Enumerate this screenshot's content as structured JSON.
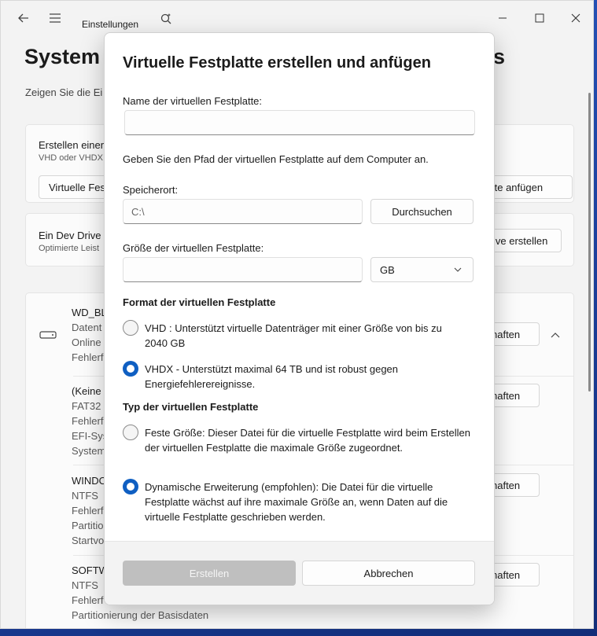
{
  "app": {
    "title": "Einstellungen"
  },
  "page": {
    "title": "System",
    "title_suffix": "s",
    "subtitle": "Zeigen Sie die Ei"
  },
  "cards": {
    "vhd": {
      "title": "Erstellen einer",
      "desc": "VHD oder VHDX",
      "btn_left": "Virtuelle Fes",
      "btn_right": "tte anfügen"
    },
    "devdrive": {
      "title": "Ein Dev Drive",
      "desc": "Optimierte Leist",
      "btn_right": "ive erstellen"
    }
  },
  "disks": [
    {
      "lines": [
        "WD_BL",
        "Datent",
        "Online",
        "Fehlerf"
      ],
      "btn": "haften"
    },
    {
      "lines": [
        "(Keine",
        "FAT32",
        "Fehlerf",
        "EFI-Sys",
        "System"
      ],
      "btn": "haften"
    },
    {
      "lines": [
        "WINDO",
        "NTFS",
        "Fehlerf",
        "Partitio",
        "Startvo"
      ],
      "btn": "haften"
    },
    {
      "lines": [
        "SOFTW",
        "NTFS",
        "Fehlerf",
        "Partitionierung der Basisdaten"
      ],
      "btn": "haften"
    }
  ],
  "dialog": {
    "title": "Virtuelle Festplatte erstellen und anfügen",
    "name_label": "Name der virtuellen Festplatte:",
    "name_value": "",
    "path_hint": "Geben Sie den Pfad der virtuellen Festplatte auf dem Computer an.",
    "location_label": "Speicherort:",
    "location_value": "C:\\",
    "browse_label": "Durchsuchen",
    "size_label": "Größe der virtuellen Festplatte:",
    "size_value": "",
    "unit_value": "GB",
    "format_heading": "Format der virtuellen Festplatte",
    "format_options": [
      {
        "text": "VHD : Unterstützt virtuelle Datenträger mit einer Größe von bis zu 2040 GB",
        "selected": false
      },
      {
        "text": "VHDX - Unterstützt maximal 64 TB und ist robust gegen Energiefehlerereignisse.",
        "selected": true
      }
    ],
    "type_heading": "Typ der virtuellen Festplatte",
    "type_options": [
      {
        "text": "Feste Größe: Dieser Datei für die virtuelle Festplatte wird beim Erstellen der virtuellen Festplatte die maximale Größe zugeordnet.",
        "selected": false
      },
      {
        "text": "Dynamische Erweiterung (empfohlen): Die Datei für die virtuelle Festplatte wächst auf ihre maximale Größe an, wenn Daten auf die virtuelle Festplatte geschrieben werden.",
        "selected": true
      }
    ],
    "create_label": "Erstellen",
    "cancel_label": "Abbrechen"
  },
  "colors": {
    "accent": "#0f5fc2",
    "disabled_button": "#bfbfbf"
  }
}
